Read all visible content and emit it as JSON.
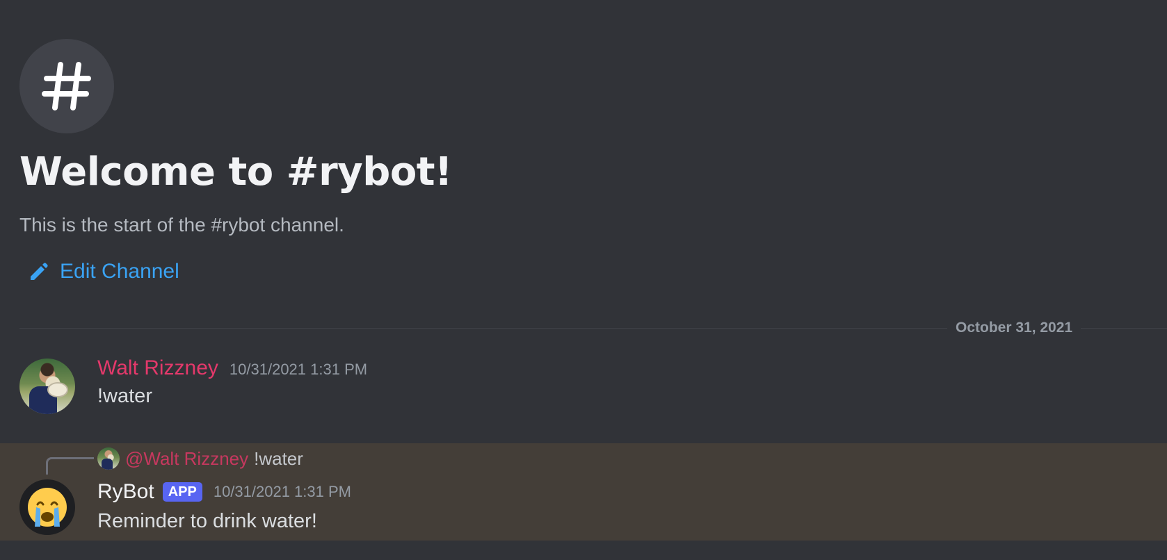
{
  "channel": {
    "icon": "hash-icon",
    "welcome_title": "Welcome to #rybot!",
    "description": "This is the start of the #rybot channel.",
    "edit_label": "Edit Channel",
    "edit_icon": "pencil-icon"
  },
  "divider": {
    "date": "October 31, 2021"
  },
  "messages": [
    {
      "author": "Walt Rizzney",
      "author_color": "#e4396b",
      "timestamp": "10/31/2021 1:31 PM",
      "content": "!water"
    },
    {
      "reply": {
        "mention": "@Walt Rizzney",
        "content": "!water"
      },
      "author": "RyBot",
      "badge": "APP",
      "badge_color": "#5865f2",
      "timestamp": "10/31/2021 1:31 PM",
      "content": "Reminder to drink water!",
      "avatar_icon": "crying-face-icon",
      "highlight_color": "#443e38"
    }
  ],
  "colors": {
    "background": "#313338",
    "link": "#3aa3f4"
  }
}
